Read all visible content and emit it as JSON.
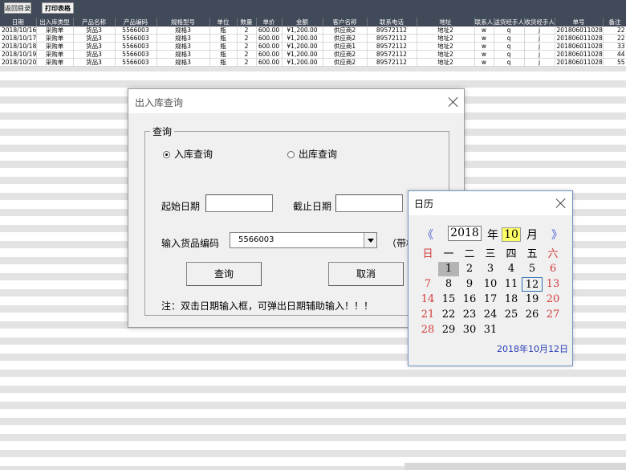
{
  "toolbar": {
    "return_label": "返回目录",
    "print_label": "打印表格"
  },
  "table": {
    "headers": [
      "日期",
      "出入库类型",
      "产品名称",
      "产品编码",
      "规格型号",
      "单位",
      "数量",
      "单价",
      "金额",
      "客户名称",
      "联系电话",
      "地址",
      "联系人",
      "送货经手人",
      "收货经手人",
      "单号",
      "备注"
    ],
    "rows": [
      [
        "2018/10/16",
        "采购单",
        "货品3",
        "5566003",
        "规格3",
        "瓶",
        "2",
        "600.00",
        "¥1,200.00",
        "供应商2",
        "89572112",
        "地址2",
        "w",
        "q",
        "j",
        "201806011028",
        "22"
      ],
      [
        "2018/10/17",
        "采购单",
        "货品3",
        "5566003",
        "规格3",
        "瓶",
        "2",
        "600.00",
        "¥1,200.00",
        "供应商2",
        "89572112",
        "地址2",
        "w",
        "q",
        "j",
        "201806011028",
        "22"
      ],
      [
        "2018/10/18",
        "采购单",
        "货品3",
        "5566003",
        "规格3",
        "瓶",
        "2",
        "600.00",
        "¥1,200.00",
        "供应商1",
        "89572112",
        "地址2",
        "w",
        "q",
        "j",
        "201806011028",
        "33"
      ],
      [
        "2018/10/19",
        "采购单",
        "货品3",
        "5566003",
        "规格3",
        "瓶",
        "2",
        "600.00",
        "¥1,200.00",
        "供应商2",
        "89572112",
        "地址2",
        "w",
        "q",
        "j",
        "201806011028",
        "44"
      ],
      [
        "2018/10/20",
        "采购单",
        "货品3",
        "5566003",
        "规格3",
        "瓶",
        "2",
        "600.00",
        "¥1,200.00",
        "供应商2",
        "89572112",
        "地址2",
        "w",
        "q",
        "j",
        "201806011028",
        "55"
      ]
    ]
  },
  "dialog": {
    "title": "出入库查询",
    "group_label": "查询",
    "radio_in": "入库查询",
    "radio_out": "出库查询",
    "selected_radio": "in",
    "start_date_label": "起始日期",
    "end_date_label": "截止日期",
    "code_label": "输入货品编码",
    "code_value": "5566003",
    "code_hint": "（带横",
    "query_button": "查询",
    "cancel_button": "取消",
    "note": "注：双击日期输入框，可弹出日期辅助输入！！！"
  },
  "calendar": {
    "title": "日历",
    "prev_symbol": "《",
    "next_symbol": "》",
    "year": "2018",
    "year_label": "年",
    "month": "10",
    "month_label": "月",
    "weekdays": [
      "日",
      "一",
      "二",
      "三",
      "四",
      "五",
      "六"
    ],
    "first_weekday": 1,
    "days_in_month": 31,
    "highlight_day": 1,
    "selected_day": 12,
    "today_text": "2018年10月12日",
    "colors": {
      "weekend": "#d23a3a",
      "nav": "#4a5fd0",
      "today": "#2a3fb6"
    }
  }
}
